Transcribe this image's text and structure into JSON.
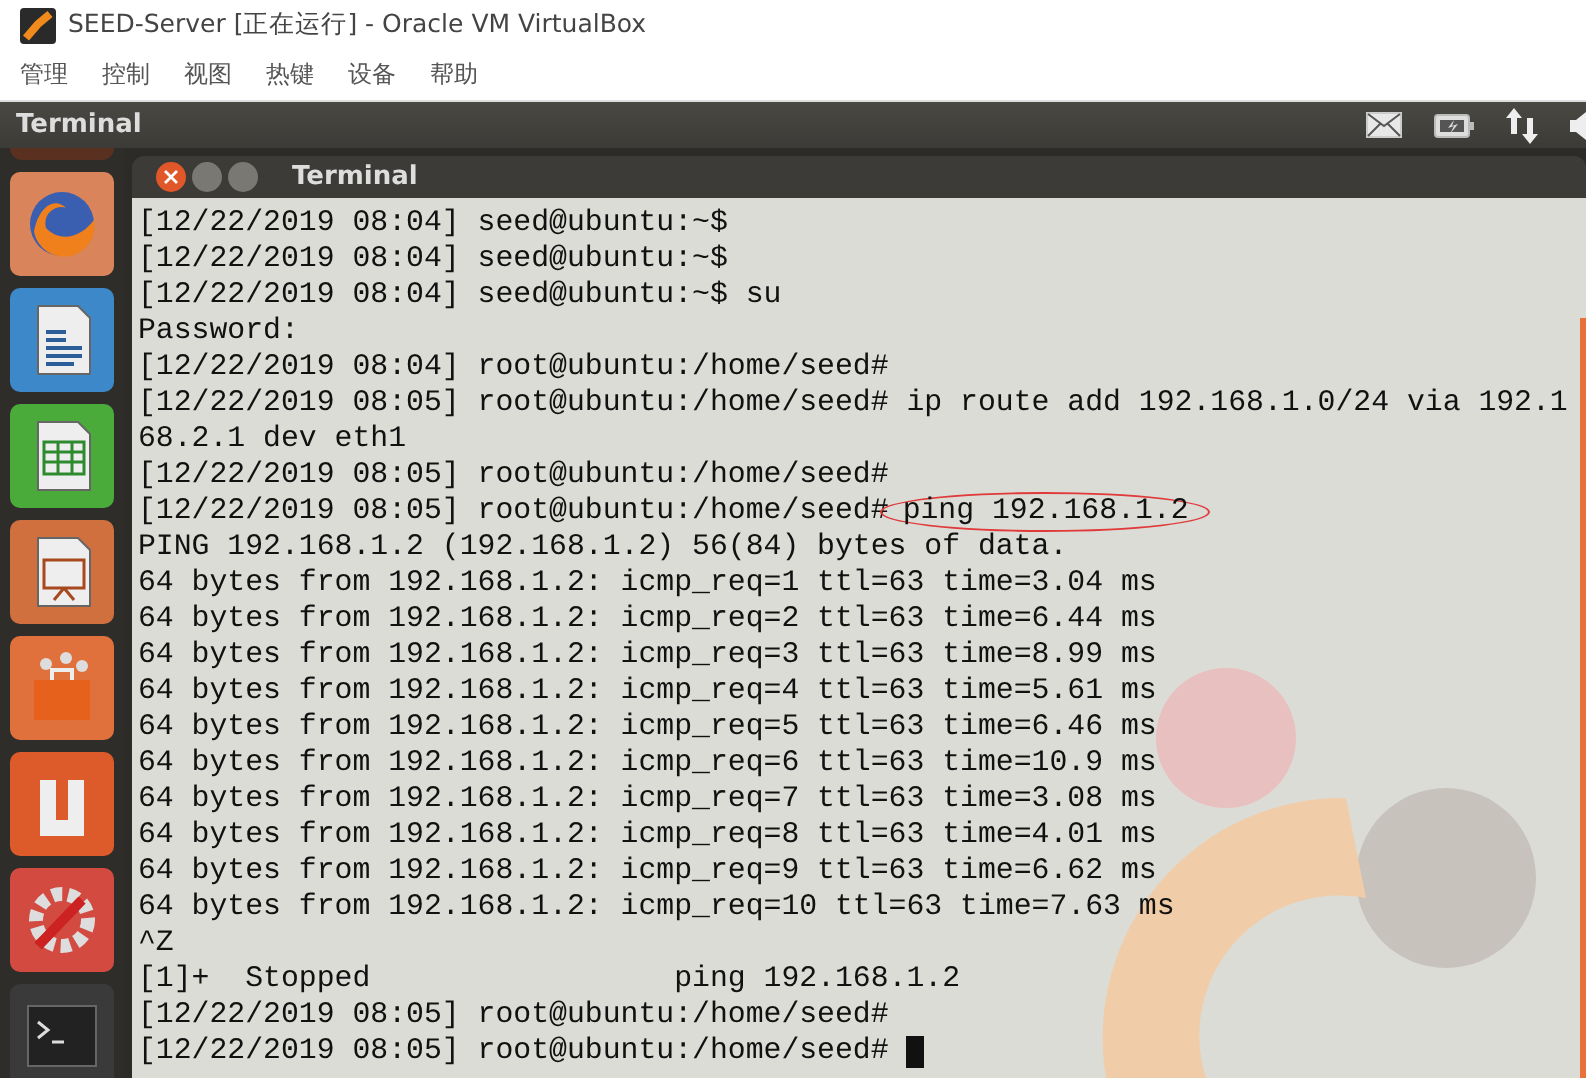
{
  "window": {
    "title": "SEED-Server [正在运行] - Oracle VM VirtualBox"
  },
  "menu": [
    "管理",
    "控制",
    "视图",
    "热键",
    "设备",
    "帮助"
  ],
  "top_panel": {
    "title": "Terminal"
  },
  "launcher": {
    "items": [
      {
        "kind": "firefox"
      },
      {
        "kind": "writer"
      },
      {
        "kind": "calc"
      },
      {
        "kind": "impress"
      },
      {
        "kind": "store"
      },
      {
        "kind": "ubuntu-one"
      },
      {
        "kind": "settings"
      },
      {
        "kind": "terminal"
      }
    ]
  },
  "terminal": {
    "title": "Terminal",
    "lines": [
      {
        "text": "[12/22/2019 08:04] seed@ubuntu:~$"
      },
      {
        "text": "[12/22/2019 08:04] seed@ubuntu:~$"
      },
      {
        "text": "[12/22/2019 08:04] seed@ubuntu:~$ su"
      },
      {
        "text": "Password:"
      },
      {
        "text": "[12/22/2019 08:04] root@ubuntu:/home/seed#"
      },
      {
        "text": "[12/22/2019 08:05] root@ubuntu:/home/seed# ip route add 192.168.1.0/24 via 192.1"
      },
      {
        "text": "68.2.1 dev eth1"
      },
      {
        "text": "[12/22/2019 08:05] root@ubuntu:/home/seed#"
      },
      {
        "text": "[12/22/2019 08:05] root@ubuntu:/home/seed#",
        "circled_command": "ping 192.168.1.2"
      },
      {
        "text": "PING 192.168.1.2 (192.168.1.2) 56(84) bytes of data."
      },
      {
        "text": "64 bytes from 192.168.1.2: icmp_req=1 ttl=63 time=3.04 ms"
      },
      {
        "text": "64 bytes from 192.168.1.2: icmp_req=2 ttl=63 time=6.44 ms"
      },
      {
        "text": "64 bytes from 192.168.1.2: icmp_req=3 ttl=63 time=8.99 ms"
      },
      {
        "text": "64 bytes from 192.168.1.2: icmp_req=4 ttl=63 time=5.61 ms"
      },
      {
        "text": "64 bytes from 192.168.1.2: icmp_req=5 ttl=63 time=6.46 ms"
      },
      {
        "text": "64 bytes from 192.168.1.2: icmp_req=6 ttl=63 time=10.9 ms"
      },
      {
        "text": "64 bytes from 192.168.1.2: icmp_req=7 ttl=63 time=3.08 ms"
      },
      {
        "text": "64 bytes from 192.168.1.2: icmp_req=8 ttl=63 time=4.01 ms"
      },
      {
        "text": "64 bytes from 192.168.1.2: icmp_req=9 ttl=63 time=6.62 ms"
      },
      {
        "text": "64 bytes from 192.168.1.2: icmp_req=10 ttl=63 time=7.63 ms"
      },
      {
        "text": "^Z"
      },
      {
        "text": "[1]+  Stopped                 ping 192.168.1.2"
      },
      {
        "text": "[12/22/2019 08:05] root@ubuntu:/home/seed#"
      },
      {
        "text": "[12/22/2019 08:05] root@ubuntu:/home/seed#",
        "cursor": true
      }
    ]
  }
}
